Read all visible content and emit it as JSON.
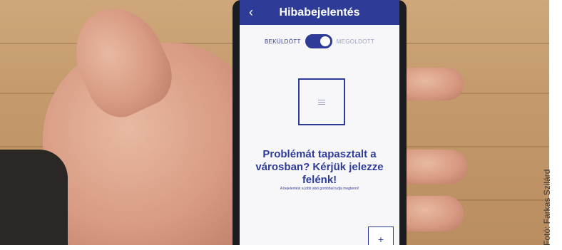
{
  "app": {
    "title": "Hibabejelentés",
    "back_icon": "chevron-left-icon"
  },
  "toggle": {
    "left_label": "BEKÜLDÖTT",
    "right_label": "MEGOLDOTT",
    "state": "right"
  },
  "main": {
    "placeholder_icon": "image-placeholder-icon",
    "headline": "Problémát tapasztalt a városban? Kérjük jelezze felénk!",
    "subtext": "A bejelentést a jobb alsó gombbal tudja megtenni!"
  },
  "add_button": {
    "label": "+"
  },
  "photo": {
    "credit": "Fotó: Farkas Szilárd"
  },
  "colors": {
    "accent": "#2f3c97",
    "screen_bg": "#f7f7f9"
  }
}
